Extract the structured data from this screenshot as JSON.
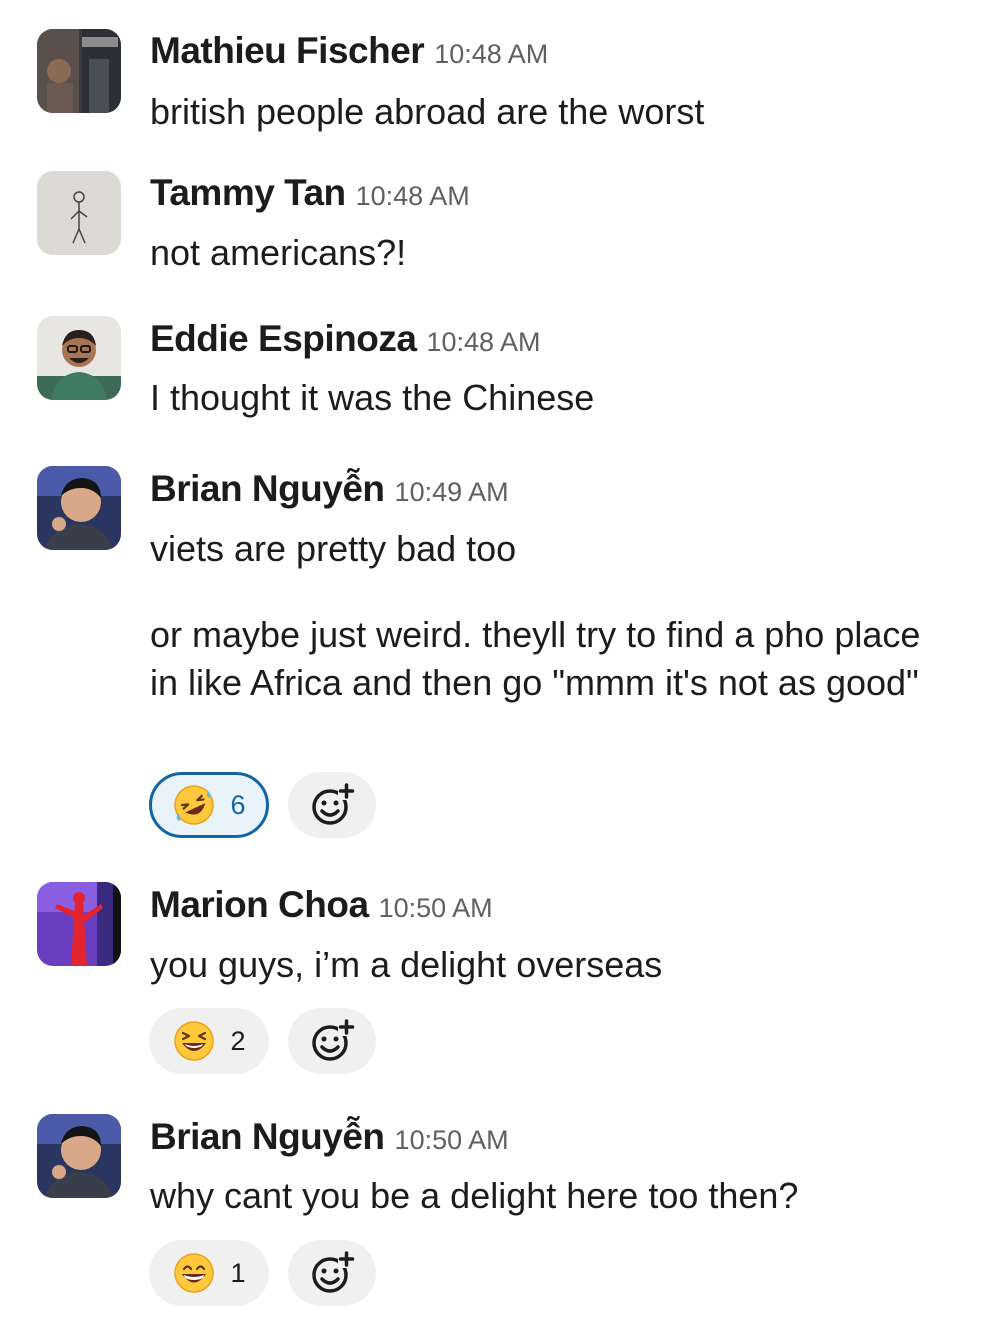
{
  "messages": [
    {
      "name": "Mathieu Fischer",
      "time": "10:48 AM",
      "text": "british people abroad are the worst"
    },
    {
      "name": "Tammy Tan",
      "time": "10:48 AM",
      "text": "not americans?!"
    },
    {
      "name": "Eddie Espinoza",
      "time": "10:48 AM",
      "text": "I thought it was the Chinese"
    },
    {
      "name": "Brian Nguyễn",
      "time": "10:49 AM",
      "text": "viets are pretty bad too",
      "text2": "or maybe just weird. theyll try to find a pho place in like Africa and then go \"mmm it's not as good\"",
      "reaction": {
        "emoji": "rolling-on-floor-laughing",
        "count": "6",
        "selected": true
      }
    },
    {
      "name": "Marion Choa",
      "time": "10:50 AM",
      "text": "you guys, i’m a delight overseas",
      "reaction": {
        "emoji": "laughing-squinting-face",
        "count": "2",
        "selected": false
      }
    },
    {
      "name": "Brian Nguyễn",
      "time": "10:50 AM",
      "text": "why cant you be a delight here too then?",
      "reaction": {
        "emoji": "grinning-face",
        "count": "1",
        "selected": false
      }
    }
  ],
  "colors": {
    "accent": "#1264a3",
    "reaction_bg": "#f0f0f0",
    "selected_bg": "#e8f4fa",
    "timestamp": "#616061"
  },
  "icons": {
    "add_reaction": "add-reaction-icon"
  }
}
